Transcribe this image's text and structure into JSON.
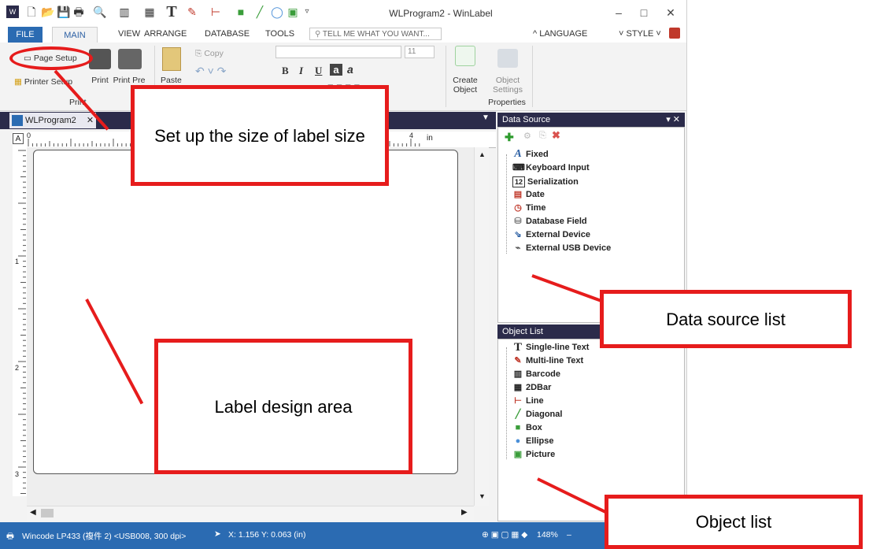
{
  "window": {
    "title": "WLProgram2 - WinLabel",
    "controls": [
      "–",
      "□",
      "✕"
    ]
  },
  "menu": {
    "file": "FILE",
    "tabs": [
      "MAIN",
      "VIEW",
      "ARRANGE",
      "DATABASE",
      "TOOLS"
    ],
    "tell_me": "TELL ME WHAT YOU WANT...",
    "language": "^ LANGUAGE",
    "style": "STYLE"
  },
  "ribbon": {
    "page_setup": "Page Setup",
    "printer_setup": "Printer Setup",
    "print": "Print",
    "print_preview": "Print Pre",
    "print_group": "Print",
    "paste": "Paste",
    "copy": "Copy",
    "font_size": "11",
    "format_buttons": [
      "B",
      "I",
      "U",
      "a",
      "a"
    ],
    "create_object": "Create Object",
    "object_settings": "Object Settings",
    "properties_group": "Properties"
  },
  "document": {
    "tab": "WLProgram2",
    "ruler_unit": "in",
    "ruler_marks": [
      "0",
      "1",
      "2",
      "3",
      "4"
    ]
  },
  "data_source": {
    "title": "Data Source",
    "items": [
      "Fixed",
      "Keyboard Input",
      "Serialization",
      "Date",
      "Time",
      "Database Field",
      "External Device",
      "External USB Device"
    ]
  },
  "object_list": {
    "title": "Object List",
    "items": [
      "Single-line Text",
      "Multi-line Text",
      "Barcode",
      "2DBar",
      "Line",
      "Diagonal",
      "Box",
      "Ellipse",
      "Picture"
    ]
  },
  "status": {
    "printer": "Wincode LP433 (複件 2) <USB008, 300 dpi>",
    "coords": "X: 1.156  Y: 0.063 (in)",
    "zoom": "148%"
  },
  "annotations": {
    "page_setup_callout": "Set up the size of label size",
    "design_area_callout": "Label design area",
    "data_source_callout": "Data source list",
    "object_list_callout": "Object list"
  },
  "colors": {
    "accent_blue": "#2b6bb2",
    "panel_header": "#2b2b4a",
    "annotation_red": "#e61c1c"
  }
}
